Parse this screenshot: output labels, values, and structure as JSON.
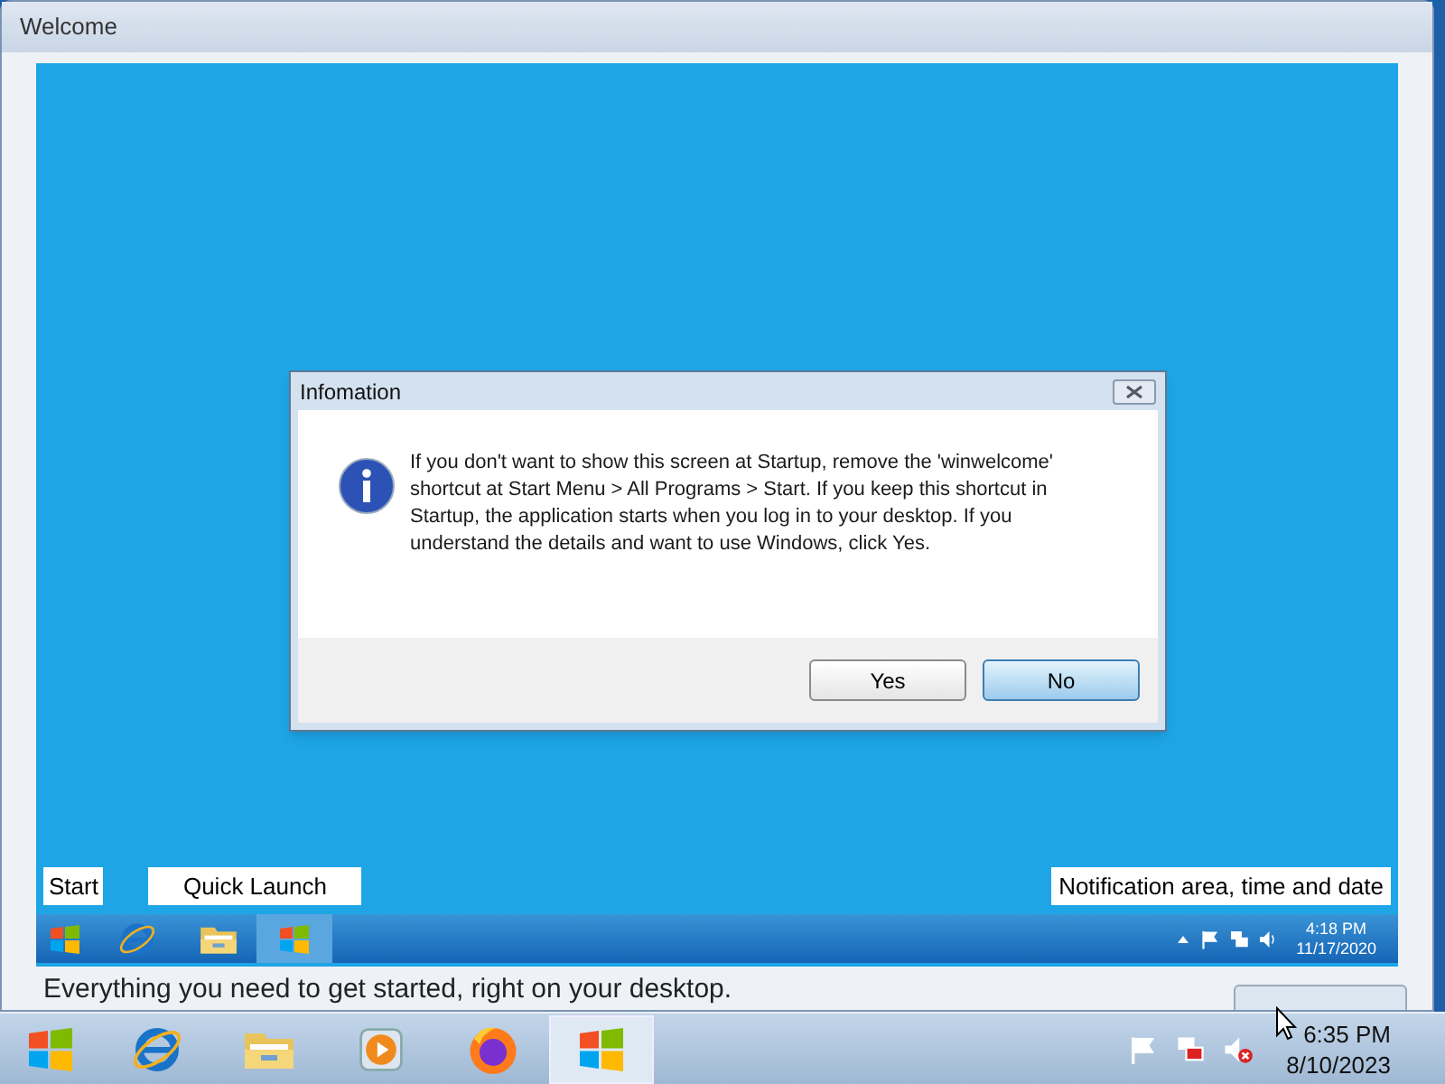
{
  "window": {
    "title": "Welcome"
  },
  "dialog": {
    "title": "Infomation",
    "message": "If you don't want to show this screen at Startup, remove the 'winwelcome' shortcut at Start Menu > All Programs > Start. If you keep this shortcut in Startup, the application starts when you log in to your desktop. If you understand the details and want to use Windows, click Yes.",
    "buttons": [
      {
        "label": "Yes",
        "selected": false
      },
      {
        "label": "No",
        "selected": true
      }
    ]
  },
  "callouts": [
    {
      "label": "Start"
    },
    {
      "label": "Quick Launch"
    },
    {
      "label": "Notification area, time and date"
    }
  ],
  "preview_taskbar": {
    "time": "4:18 PM",
    "date": "11/17/2020"
  },
  "tagline": "Everything you need to get started, right on your desktop.",
  "taskbar": {
    "time": "6:35 PM",
    "date": "8/10/2023"
  }
}
